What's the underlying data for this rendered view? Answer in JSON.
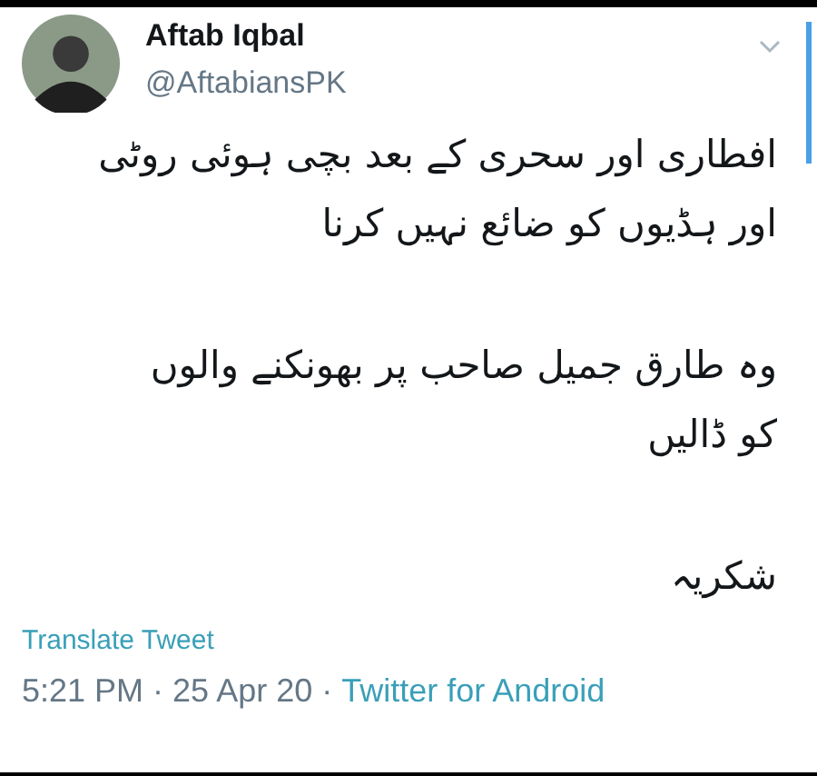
{
  "author": {
    "name": "Aftab Iqbal",
    "handle": "@AftabiansPK"
  },
  "body": [
    {
      "lines": [
        "افطاری اور سحری کے بعد بچی ہوئی روٹی",
        "اور ہڈیوں کو ضائع نہیں کرنا"
      ]
    },
    {
      "lines": [
        "وہ طارق جمیل صاحب پر بھونکنے والوں",
        "کو ڈالیں"
      ]
    },
    {
      "lines": [
        "شکریہ"
      ]
    }
  ],
  "translate_link": "Translate Tweet",
  "meta": {
    "time": "5:21 PM",
    "separator": "·",
    "date": "25 Apr 20",
    "source": "Twitter for Android"
  }
}
